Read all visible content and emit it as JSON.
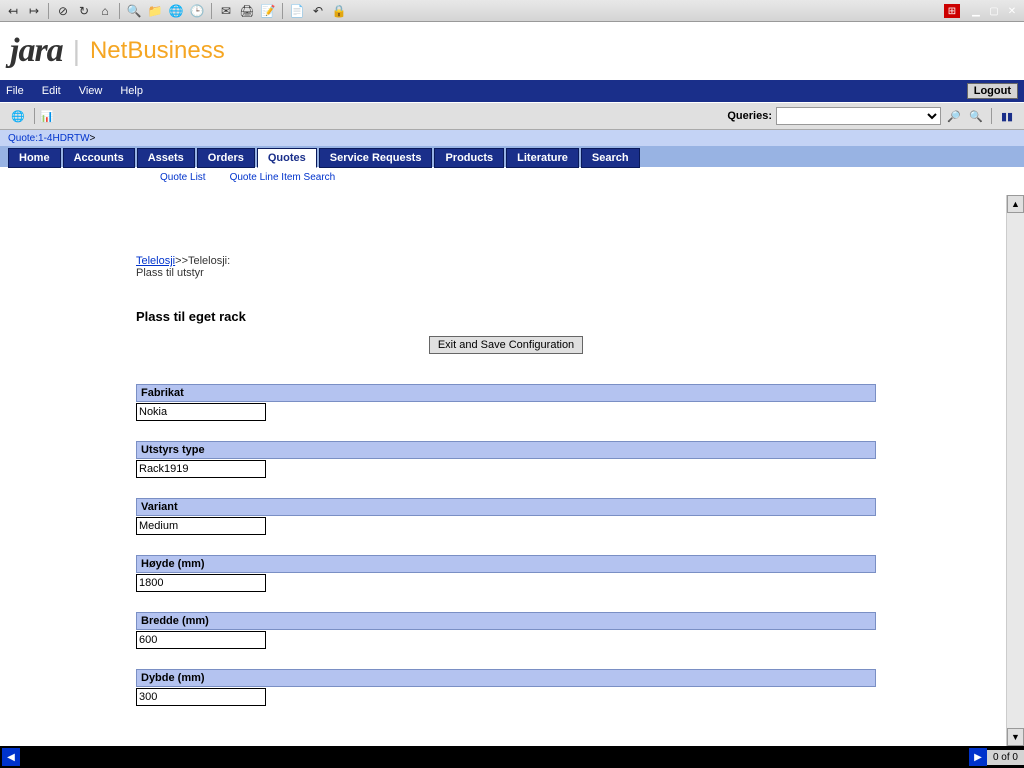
{
  "brand": {
    "logo1": "jara",
    "logo2": "NetBusiness"
  },
  "menubar": {
    "file": "File",
    "edit": "Edit",
    "view": "View",
    "help": "Help",
    "logout": "Logout"
  },
  "queries": {
    "label": "Queries:"
  },
  "breadcrumb": {
    "text": "Quote:1-4HDRTW",
    "sep": "  >"
  },
  "tabs": {
    "home": "Home",
    "accounts": "Accounts",
    "assets": "Assets",
    "orders": "Orders",
    "quotes": "Quotes",
    "service_requests": "Service Requests",
    "products": "Products",
    "literature": "Literature",
    "search": "Search"
  },
  "subtabs": {
    "quote_list": "Quote List",
    "quote_line_item_search": "Quote Line Item Search"
  },
  "page": {
    "crumb_link": "Telelosji",
    "crumb_sep": ">>",
    "crumb_rest": "Telelosji: Plass til utstyr",
    "title": "Plass til eget rack",
    "exit_button": "Exit and Save Configuration"
  },
  "fields": {
    "fabrikat": {
      "label": "Fabrikat",
      "value": "Nokia"
    },
    "utstyrs_type": {
      "label": "Utstyrs type",
      "value": "Rack1919"
    },
    "variant": {
      "label": "Variant",
      "value": "Medium"
    },
    "hoyde": {
      "label": "Høyde (mm)",
      "value": "1800"
    },
    "bredde": {
      "label": "Bredde (mm)",
      "value": "600"
    },
    "dybde": {
      "label": "Dybde (mm)",
      "value": "300"
    }
  },
  "statusbar": {
    "count": "0 of 0"
  }
}
